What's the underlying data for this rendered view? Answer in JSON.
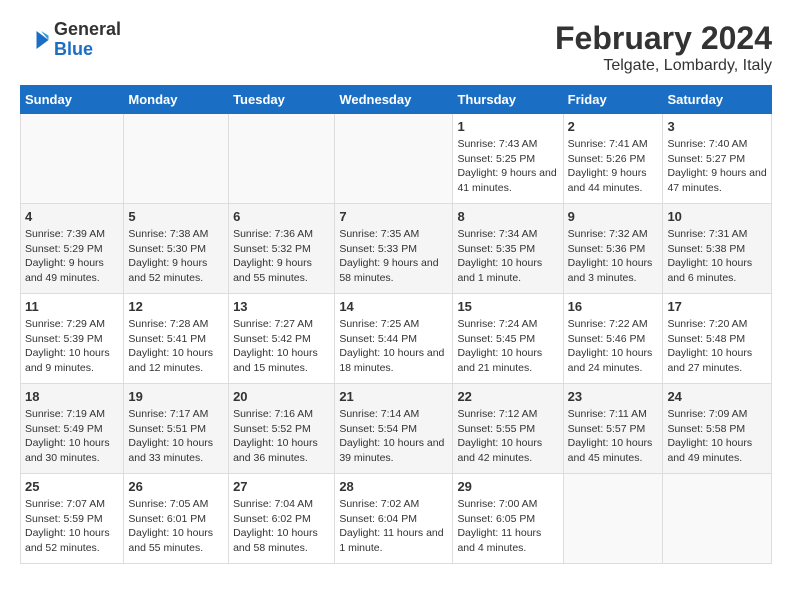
{
  "header": {
    "logo_line1": "General",
    "logo_line2": "Blue",
    "main_title": "February 2024",
    "subtitle": "Telgate, Lombardy, Italy"
  },
  "calendar": {
    "days_of_week": [
      "Sunday",
      "Monday",
      "Tuesday",
      "Wednesday",
      "Thursday",
      "Friday",
      "Saturday"
    ],
    "weeks": [
      [
        {
          "day": "",
          "empty": true
        },
        {
          "day": "",
          "empty": true
        },
        {
          "day": "",
          "empty": true
        },
        {
          "day": "",
          "empty": true
        },
        {
          "day": "1",
          "sunrise": "7:43 AM",
          "sunset": "5:25 PM",
          "daylight": "9 hours and 41 minutes."
        },
        {
          "day": "2",
          "sunrise": "7:41 AM",
          "sunset": "5:26 PM",
          "daylight": "9 hours and 44 minutes."
        },
        {
          "day": "3",
          "sunrise": "7:40 AM",
          "sunset": "5:27 PM",
          "daylight": "9 hours and 47 minutes."
        }
      ],
      [
        {
          "day": "4",
          "sunrise": "7:39 AM",
          "sunset": "5:29 PM",
          "daylight": "9 hours and 49 minutes."
        },
        {
          "day": "5",
          "sunrise": "7:38 AM",
          "sunset": "5:30 PM",
          "daylight": "9 hours and 52 minutes."
        },
        {
          "day": "6",
          "sunrise": "7:36 AM",
          "sunset": "5:32 PM",
          "daylight": "9 hours and 55 minutes."
        },
        {
          "day": "7",
          "sunrise": "7:35 AM",
          "sunset": "5:33 PM",
          "daylight": "9 hours and 58 minutes."
        },
        {
          "day": "8",
          "sunrise": "7:34 AM",
          "sunset": "5:35 PM",
          "daylight": "10 hours and 1 minute."
        },
        {
          "day": "9",
          "sunrise": "7:32 AM",
          "sunset": "5:36 PM",
          "daylight": "10 hours and 3 minutes."
        },
        {
          "day": "10",
          "sunrise": "7:31 AM",
          "sunset": "5:38 PM",
          "daylight": "10 hours and 6 minutes."
        }
      ],
      [
        {
          "day": "11",
          "sunrise": "7:29 AM",
          "sunset": "5:39 PM",
          "daylight": "10 hours and 9 minutes."
        },
        {
          "day": "12",
          "sunrise": "7:28 AM",
          "sunset": "5:41 PM",
          "daylight": "10 hours and 12 minutes."
        },
        {
          "day": "13",
          "sunrise": "7:27 AM",
          "sunset": "5:42 PM",
          "daylight": "10 hours and 15 minutes."
        },
        {
          "day": "14",
          "sunrise": "7:25 AM",
          "sunset": "5:44 PM",
          "daylight": "10 hours and 18 minutes."
        },
        {
          "day": "15",
          "sunrise": "7:24 AM",
          "sunset": "5:45 PM",
          "daylight": "10 hours and 21 minutes."
        },
        {
          "day": "16",
          "sunrise": "7:22 AM",
          "sunset": "5:46 PM",
          "daylight": "10 hours and 24 minutes."
        },
        {
          "day": "17",
          "sunrise": "7:20 AM",
          "sunset": "5:48 PM",
          "daylight": "10 hours and 27 minutes."
        }
      ],
      [
        {
          "day": "18",
          "sunrise": "7:19 AM",
          "sunset": "5:49 PM",
          "daylight": "10 hours and 30 minutes."
        },
        {
          "day": "19",
          "sunrise": "7:17 AM",
          "sunset": "5:51 PM",
          "daylight": "10 hours and 33 minutes."
        },
        {
          "day": "20",
          "sunrise": "7:16 AM",
          "sunset": "5:52 PM",
          "daylight": "10 hours and 36 minutes."
        },
        {
          "day": "21",
          "sunrise": "7:14 AM",
          "sunset": "5:54 PM",
          "daylight": "10 hours and 39 minutes."
        },
        {
          "day": "22",
          "sunrise": "7:12 AM",
          "sunset": "5:55 PM",
          "daylight": "10 hours and 42 minutes."
        },
        {
          "day": "23",
          "sunrise": "7:11 AM",
          "sunset": "5:57 PM",
          "daylight": "10 hours and 45 minutes."
        },
        {
          "day": "24",
          "sunrise": "7:09 AM",
          "sunset": "5:58 PM",
          "daylight": "10 hours and 49 minutes."
        }
      ],
      [
        {
          "day": "25",
          "sunrise": "7:07 AM",
          "sunset": "5:59 PM",
          "daylight": "10 hours and 52 minutes."
        },
        {
          "day": "26",
          "sunrise": "7:05 AM",
          "sunset": "6:01 PM",
          "daylight": "10 hours and 55 minutes."
        },
        {
          "day": "27",
          "sunrise": "7:04 AM",
          "sunset": "6:02 PM",
          "daylight": "10 hours and 58 minutes."
        },
        {
          "day": "28",
          "sunrise": "7:02 AM",
          "sunset": "6:04 PM",
          "daylight": "11 hours and 1 minute."
        },
        {
          "day": "29",
          "sunrise": "7:00 AM",
          "sunset": "6:05 PM",
          "daylight": "11 hours and 4 minutes."
        },
        {
          "day": "",
          "empty": true
        },
        {
          "day": "",
          "empty": true
        }
      ]
    ]
  }
}
